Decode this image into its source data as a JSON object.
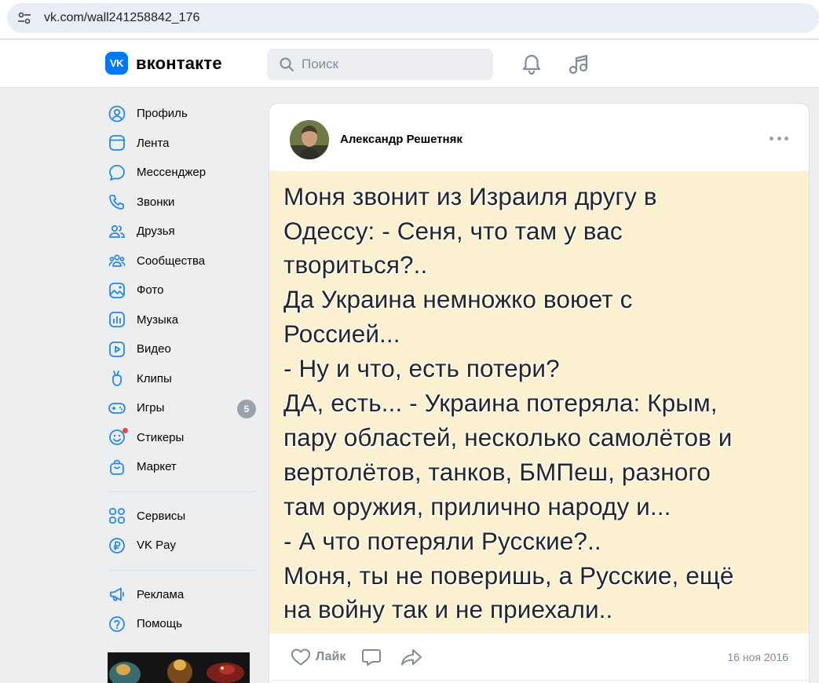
{
  "browser": {
    "url": "vk.com/wall241258842_176"
  },
  "header": {
    "logo_mark": "VK",
    "logo_text": "вконтакте",
    "search_placeholder": "Поиск",
    "accent_color": "#0077ff"
  },
  "sidebar": {
    "items": [
      {
        "label": "Профиль",
        "icon": "profile-icon"
      },
      {
        "label": "Лента",
        "icon": "feed-icon"
      },
      {
        "label": "Мессенджер",
        "icon": "messenger-icon"
      },
      {
        "label": "Звонки",
        "icon": "phone-icon"
      },
      {
        "label": "Друзья",
        "icon": "friends-icon"
      },
      {
        "label": "Сообщества",
        "icon": "communities-icon"
      },
      {
        "label": "Фото",
        "icon": "photo-icon"
      },
      {
        "label": "Музыка",
        "icon": "music-icon"
      },
      {
        "label": "Видео",
        "icon": "video-icon"
      },
      {
        "label": "Клипы",
        "icon": "clips-icon"
      },
      {
        "label": "Игры",
        "icon": "games-icon",
        "badge": "5"
      },
      {
        "label": "Стикеры",
        "icon": "stickers-icon"
      },
      {
        "label": "Маркет",
        "icon": "market-icon"
      }
    ],
    "secondary_items": [
      {
        "label": "Сервисы",
        "icon": "services-icon"
      },
      {
        "label": "VK Pay",
        "icon": "vkpay-icon"
      }
    ],
    "tertiary_items": [
      {
        "label": "Реклама",
        "icon": "ads-icon"
      },
      {
        "label": "Помощь",
        "icon": "help-icon"
      }
    ]
  },
  "post": {
    "author": "Александр Решетняк",
    "image_text_lines": [
      "Моня звонит из Израиля другу в",
      "Одессу: - Сеня, что там у вас",
      "твориться?..",
      "Да Украина немножко воюет с",
      "Россией...",
      "- Ну и что, есть потери?",
      "ДА, есть... - Украина потеряла: Крым,",
      "пару областей, несколько самолётов и",
      "вертолётов, танков, БМПеш, разного",
      "там оружия, прилично народу и...",
      "- А что потеряли Русские?..",
      "Моня, ты не поверишь, а Русские, ещё",
      "на войну так и не приехали.."
    ],
    "like_label": "Лайк",
    "date": "16 ноя 2016"
  }
}
